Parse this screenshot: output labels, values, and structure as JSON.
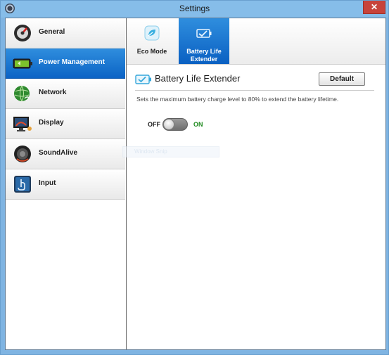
{
  "window": {
    "title": "Settings",
    "close_glyph": "✕",
    "icon": "settings-app-icon",
    "title_bar_color": "#86bde9",
    "close_color": "#c7433b"
  },
  "sidebar": {
    "items": [
      {
        "label": "General",
        "icon": "general-gauge-icon",
        "active": false
      },
      {
        "label": "Power Management",
        "icon": "battery-icon",
        "active": true
      },
      {
        "label": "Network",
        "icon": "globe-wifi-icon",
        "active": false
      },
      {
        "label": "Display",
        "icon": "monitor-icon",
        "active": false
      },
      {
        "label": "SoundAlive",
        "icon": "speaker-icon",
        "active": false
      },
      {
        "label": "Input",
        "icon": "touch-hand-icon",
        "active": false
      }
    ]
  },
  "tabs": [
    {
      "label": "Eco Mode",
      "icon": "eco-leaf-icon",
      "active": false
    },
    {
      "label": "Battery Life Extender",
      "icon": "battery-check-icon",
      "active": true
    }
  ],
  "section": {
    "title": "Battery Life Extender",
    "icon": "battery-check-icon",
    "default_label": "Default",
    "description": "Sets the maximum battery charge level to 80% to extend the battery lifetime."
  },
  "toggle": {
    "off_label": "OFF",
    "on_label": "ON",
    "state": "off"
  },
  "overlay": {
    "ghost_label": "Window Snip"
  },
  "colors": {
    "accent": "#0b63c5",
    "on_text": "#1f8a1f"
  }
}
